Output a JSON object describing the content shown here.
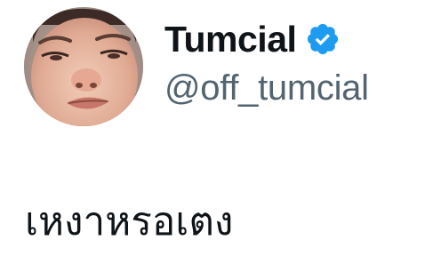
{
  "author": {
    "display_name": "Tumcial",
    "handle": "@off_tumcial",
    "verified": true,
    "verified_color": "#1d9bf0",
    "avatar": "profile-photo"
  },
  "tweet": {
    "text": "เหงาหรอเตง"
  },
  "colors": {
    "primary_text": "#0f1419",
    "secondary_text": "#536471",
    "background": "#ffffff"
  }
}
